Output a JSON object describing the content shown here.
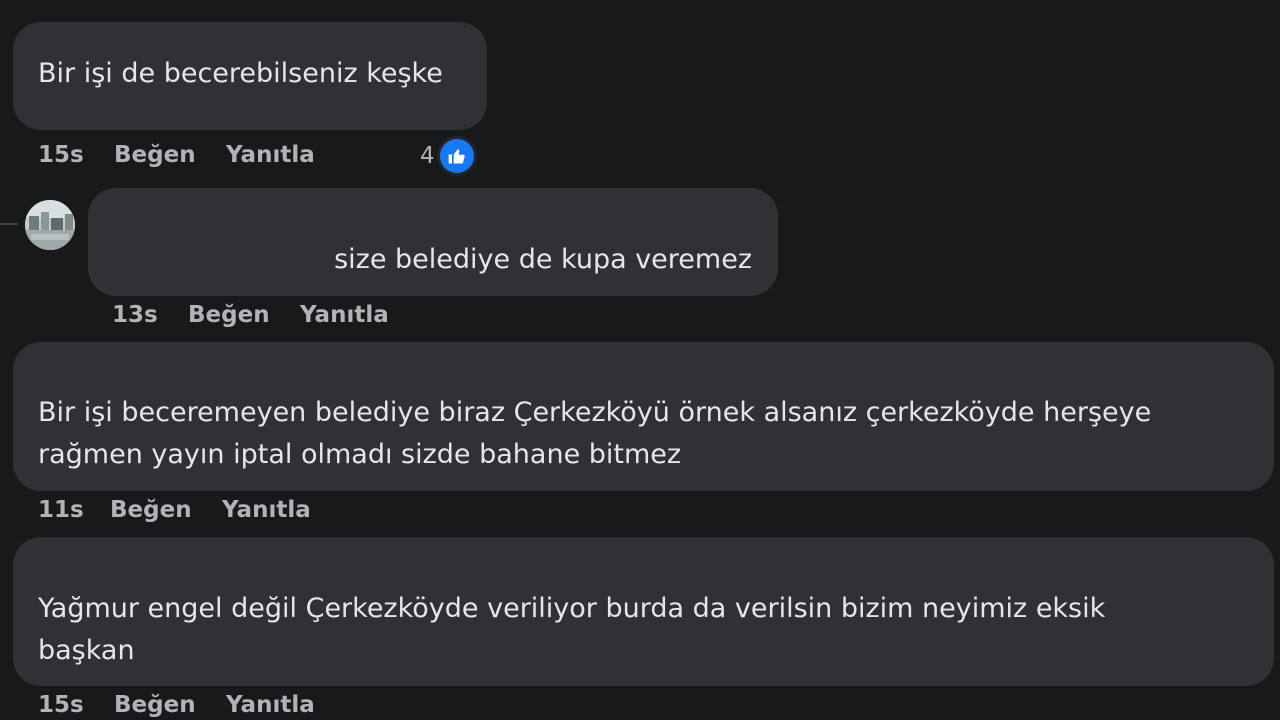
{
  "comments": [
    {
      "text": "Bir işi de becerebilseniz keşke",
      "time": "15s",
      "like_label": "Beğen",
      "reply_label": "Yanıtla",
      "reaction_count": "4",
      "reaction_icon": "like-icon"
    },
    {
      "text": "size belediye de kupa veremez",
      "time": "13s",
      "like_label": "Beğen",
      "reply_label": "Yanıtla"
    },
    {
      "text_line1": "Bir işi beceremeyen belediye biraz Çerkezköyü örnek alsanız çerkezköyde herşeye",
      "text_line2": "rağmen yayın iptal olmadı sizde bahane bitmez",
      "time": "11s",
      "like_label": "Beğen",
      "reply_label": "Yanıtla"
    },
    {
      "text_line1": "Yağmur engel değil Çerkezköyde veriliyor burda da verilsin bizim neyimiz eksik",
      "text_line2": "başkan",
      "time": "15s",
      "like_label": "Beğen",
      "reply_label": "Yanıtla"
    }
  ],
  "colors": {
    "background": "#18191a",
    "bubble": "#303134",
    "text": "#e4e6eb",
    "secondary_text": "#b0b3b8",
    "like_blue": "#1877f2"
  }
}
